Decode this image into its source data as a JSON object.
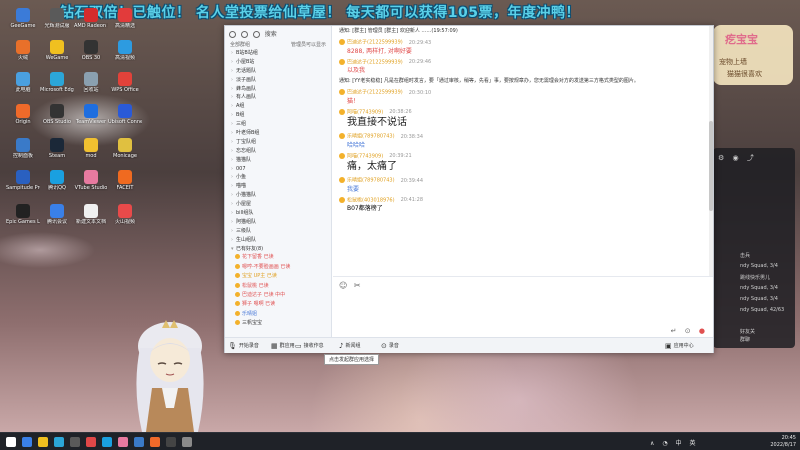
{
  "banner": {
    "text": "钻石双倍！已触位！ 名人堂投票给仙草屋！ 每天都可以获得105票，年度冲鸭！"
  },
  "desktop_icons": [
    {
      "label": "GeeGame",
      "color": "#3b7bd8"
    },
    {
      "label": "光辉测试服",
      "color": "#5a5a5a"
    },
    {
      "label": "AMD Radeon Software",
      "color": "#d62c2c"
    },
    {
      "label": "高清精选",
      "color": "#e23b3b"
    },
    {
      "label": "火绒",
      "color": "#e8702a"
    },
    {
      "label": "WeGame",
      "color": "#f0c020"
    },
    {
      "label": "OBS 30",
      "color": "#333"
    },
    {
      "label": "高清视频",
      "color": "#2d9be0"
    },
    {
      "label": "此电脑",
      "color": "#4aa0e0"
    },
    {
      "label": "Microsoft Edge",
      "color": "#2ba6d8"
    },
    {
      "label": "回收站",
      "color": "#8aa0b0"
    },
    {
      "label": "WPS Office",
      "color": "#e2423a"
    },
    {
      "label": "Origin",
      "color": "#f06a2a"
    },
    {
      "label": "OBS Studio",
      "color": "#333"
    },
    {
      "label": "TeamViewer",
      "color": "#1e6ee0"
    },
    {
      "label": "Ubisoft Connect",
      "color": "#2a5ad8"
    },
    {
      "label": "控制面板",
      "color": "#3a7ac8"
    },
    {
      "label": "Steam",
      "color": "#1b2838"
    },
    {
      "label": "mod",
      "color": "#f0c030"
    },
    {
      "label": "Monicage",
      "color": "#e0c040"
    },
    {
      "label": "Sampitude Pro X Suite",
      "color": "#2a60c0"
    },
    {
      "label": "腾讯QQ",
      "color": "#1aa0e0"
    },
    {
      "label": "VTube Studio",
      "color": "#e87aa0"
    },
    {
      "label": "FACEIT",
      "color": "#f06a20"
    },
    {
      "label": "Epic Games Launcher",
      "color": "#222"
    },
    {
      "label": "腾讯会议",
      "color": "#3a80e8"
    },
    {
      "label": "新建文本文档",
      "color": "#f0f0f0"
    },
    {
      "label": "火山视频",
      "color": "#e84a4a"
    }
  ],
  "right_panel": {
    "title": "疙宝宝",
    "line1": "宠物上墙",
    "line2": "猫猫很喜欢",
    "lines": [
      "击兵",
      "ndy Squad, 3/4",
      "跳线快乐男儿",
      "ndy Squad, 3/4",
      "ndy Squad, 3/4",
      "ndy Squad, 42/63"
    ],
    "bottom_lines": [
      "好友关",
      "群聊"
    ]
  },
  "left_panel": {
    "top_label": "搜索",
    "head_left": "全部群组",
    "head_right": "管理员可以显示",
    "groups": [
      "B站B站组",
      "小屋B站",
      "无话题队",
      "淡子画队",
      "蜂鸟画队",
      "有人画队",
      "A组",
      "B组",
      "三组",
      "叶老师B组",
      "丁宝队组",
      "忘忘组队",
      "猫猫队",
      "007",
      "小鱼",
      "喵喵",
      "小猫猫队",
      "小屋屋",
      "bill组队",
      "阿猫组队",
      "三级队",
      "生山组队"
    ],
    "members_header": "已有好友(8)",
    "members": [
      {
        "name": "花下留香 已读",
        "color": "#e05050"
      },
      {
        "name": "嗯哼-不要脸画画 已读",
        "color": "#e05050"
      },
      {
        "name": "宝宝 UP主 已读",
        "color": "#e0a020"
      },
      {
        "name": "松鼠桃 已读",
        "color": "#e05050"
      },
      {
        "name": "巴迪达子 已读 中中",
        "color": "#e05050"
      },
      {
        "name": "狮子 嗯啊 已读",
        "color": "#e05050"
      },
      {
        "name": "乐晴姐",
        "color": "#4a7ad8"
      },
      {
        "name": "三帆宝宝",
        "color": "#333"
      }
    ]
  },
  "chat": {
    "notice_top": "通知: [群主] 管理员 [群主] 欢迎新人 ……(19:57:09)",
    "messages": [
      {
        "user": "巴迪达子",
        "id": "(2122599939)",
        "time": "20:29:43",
        "text": "8288, 两样打, 对啊好要",
        "style": "red"
      },
      {
        "user": "巴迪达子",
        "id": "(2122599939)",
        "time": "20:29:46",
        "text": "以及我",
        "style": "red"
      }
    ],
    "notice_mid": "通知: [YY老实稳稳] 凡是在群组时发言，要「通过审核，稍等，先看」事，要按规章办，您无需理会对方的发送第三方格式类型的图片。",
    "messages2": [
      {
        "user": "巴迪达子",
        "id": "(2122599939)",
        "time": "20:30:10",
        "text": "猫！",
        "style": "red"
      },
      {
        "user": "阿喵",
        "id": "(7743909)",
        "time": "20:38:26",
        "text": "我直接不说话",
        "style": "big"
      },
      {
        "user": "乐晴姐",
        "id": "(789780743)",
        "time": "20:38:34",
        "text": "哈哈哈",
        "style": "blue"
      },
      {
        "user": "阿喵",
        "id": "(7743909)",
        "time": "20:39:21",
        "text": "痛，太痛了",
        "style": "big"
      },
      {
        "user": "乐晴姐",
        "id": "(789780743)",
        "time": "20:39:44",
        "text": "我要",
        "style": "blue"
      },
      {
        "user": "松鼠桃",
        "id": "(403018976)",
        "time": "20:41:28",
        "text": "B07都落榜了",
        "style": "plain"
      }
    ]
  },
  "input_tools": [
    "☺",
    "✂"
  ],
  "send_tools": [
    "↵",
    "⊙",
    "●"
  ],
  "bottom_bar": {
    "item1": "开始录音",
    "item2": "群应用",
    "item3": "接收作息",
    "item4": "新闻组",
    "item5": "录音",
    "item6": "应用中心"
  },
  "tooltip": "点击发起群应用选择",
  "taskbar": {
    "time": "20:45",
    "date": "2022/8/17",
    "tray_icons": [
      "∧",
      "◔",
      "中",
      "英"
    ]
  },
  "colors": {
    "accent_blue": "#4a7ad8",
    "user_gold": "#e0a020",
    "msg_red": "#e04848"
  }
}
